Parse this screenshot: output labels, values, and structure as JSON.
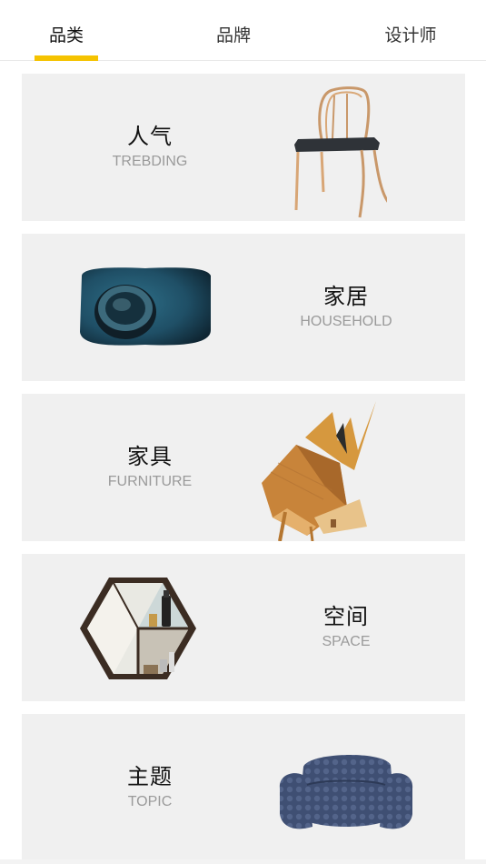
{
  "tabs": [
    {
      "label": "品类",
      "active": true
    },
    {
      "label": "品牌",
      "active": false
    },
    {
      "label": "设计师",
      "active": false
    }
  ],
  "accent_color": "#f5c300",
  "categories": [
    {
      "zh": "人气",
      "en": "TREBDING",
      "image": "wooden-chair"
    },
    {
      "zh": "家居",
      "en": "HOUSEHOLD",
      "image": "blue-ceramic-tray"
    },
    {
      "zh": "家具",
      "en": "FURNITURE",
      "image": "geometric-wood-cabinet"
    },
    {
      "zh": "空间",
      "en": "SPACE",
      "image": "hexagon-shelf"
    },
    {
      "zh": "主题",
      "en": "TOPIC",
      "image": "quilted-armchair"
    }
  ]
}
